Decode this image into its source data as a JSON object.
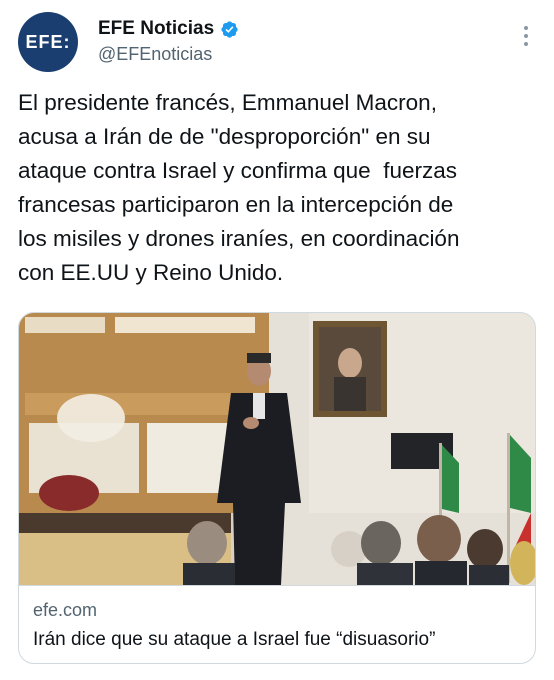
{
  "header": {
    "avatar_text": "EFE:",
    "display_name": "EFE Noticias",
    "handle": "@EFEnoticias",
    "verified": true,
    "verified_icon": "verified-badge-icon",
    "more_icon": "more-options-icon"
  },
  "tweet": {
    "text": "El presidente francés, Emmanuel Macron,\nacusa a Irán de de \"desproporción\" en su\nataque contra Israel y confirma que  fuerzas\nfrancesas participaron en la intercepción de\nlos misiles y drones iraníes, en coordinación\ncon EE.UU y Reino Unido."
  },
  "card": {
    "domain": "efe.com",
    "title": "Irán dice que su ataque a Israel fue “disuasorio”"
  },
  "colors": {
    "avatar_bg": "#1a3e6f",
    "verified_blue": "#1d9bf0",
    "text_primary": "#0f1419",
    "text_secondary": "#536471",
    "border": "#cfd9de"
  }
}
